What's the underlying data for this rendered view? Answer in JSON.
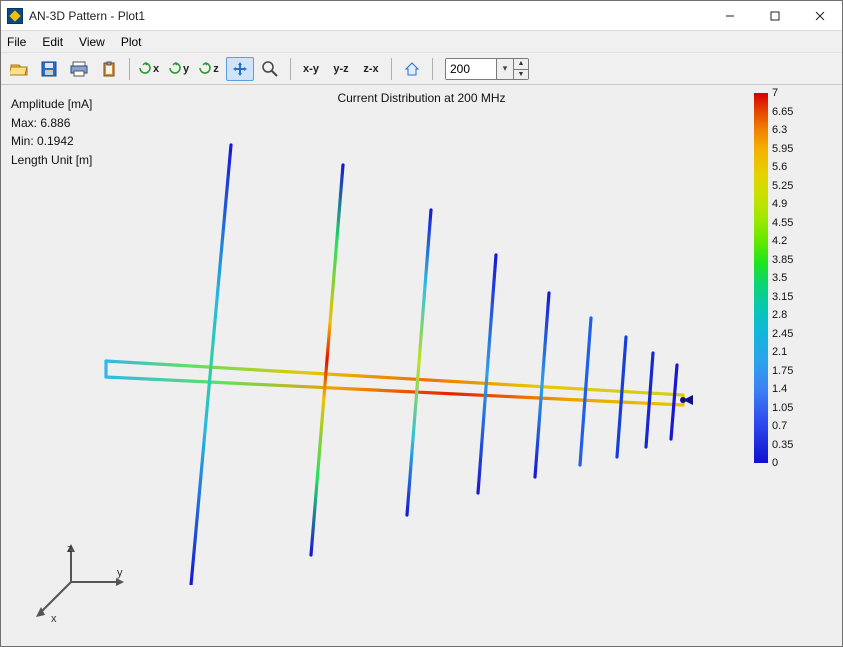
{
  "window": {
    "title": "AN-3D Pattern - Plot1"
  },
  "menus": [
    "File",
    "Edit",
    "View",
    "Plot"
  ],
  "toolbar": {
    "icons": {
      "open": "open-icon",
      "save": "save-icon",
      "print": "print-icon",
      "clipboard": "clipboard-icon",
      "rotx": "x",
      "roty": "y",
      "rotz": "z",
      "pan": "pan-icon",
      "zoom": "zoom-icon",
      "view_xy": "x-y",
      "view_yz": "y-z",
      "view_zx": "z-x",
      "home": "home-icon"
    },
    "freq": {
      "value": "200"
    }
  },
  "info": {
    "amp_label": "Amplitude [mA]",
    "max_label": "Max: 6.886",
    "min_label": "Min: 0.1942",
    "unit_label": "Length Unit [m]"
  },
  "plot": {
    "title": "Current Distribution at 200 MHz"
  },
  "legend": {
    "ticks": [
      "7",
      "6.65",
      "6.3",
      "5.95",
      "5.6",
      "5.25",
      "4.9",
      "4.55",
      "4.2",
      "3.85",
      "3.5",
      "3.15",
      "2.8",
      "2.45",
      "2.1",
      "1.75",
      "1.4",
      "1.05",
      "0.7",
      "0.35",
      "0"
    ]
  },
  "axis_labels": {
    "x": "x",
    "y": "y",
    "z": "z"
  },
  "chart_data": {
    "type": "3d-current-distribution",
    "title": "Current Distribution at 200 MHz",
    "quantity": "Amplitude",
    "unit_quantity": "mA",
    "unit_length": "m",
    "frequency_MHz": 200,
    "max": 6.886,
    "min": 0.1942,
    "colorbar_range": [
      0,
      7
    ],
    "colorbar_ticks": [
      7,
      6.65,
      6.3,
      5.95,
      5.6,
      5.25,
      4.9,
      4.55,
      4.2,
      3.85,
      3.5,
      3.15,
      2.8,
      2.45,
      2.1,
      1.75,
      1.4,
      1.05,
      0.7,
      0.35,
      0
    ],
    "elements": [
      {
        "index": 1,
        "type": "dipole",
        "approx_current_peak_mA": 1.5,
        "approx_current_ends_mA": 0.2
      },
      {
        "index": 2,
        "type": "dipole",
        "approx_current_peak_mA": 6.886,
        "approx_current_ends_mA": 0.5
      },
      {
        "index": 3,
        "type": "dipole",
        "approx_current_peak_mA": 4.5,
        "approx_current_ends_mA": 0.3
      },
      {
        "index": 4,
        "type": "dipole",
        "approx_current_peak_mA": 1.2,
        "approx_current_ends_mA": 0.2
      },
      {
        "index": 5,
        "type": "dipole",
        "approx_current_peak_mA": 0.6,
        "approx_current_ends_mA": 0.2
      },
      {
        "index": 6,
        "type": "dipole",
        "approx_current_peak_mA": 0.3,
        "approx_current_ends_mA": 0.2
      },
      {
        "index": 7,
        "type": "dipole",
        "approx_current_peak_mA": 0.25,
        "approx_current_ends_mA": 0.2
      },
      {
        "index": 8,
        "type": "dipole",
        "approx_current_peak_mA": 0.22,
        "approx_current_ends_mA": 0.2
      },
      {
        "index": 9,
        "type": "dipole",
        "approx_current_peak_mA": 0.2,
        "approx_current_ends_mA": 0.2
      },
      {
        "index": 10,
        "type": "boom-top",
        "approx_current_front_mA": 5.5,
        "approx_current_back_mA": 2.0
      },
      {
        "index": 11,
        "type": "boom-bottom",
        "approx_current_front_mA": 5.5,
        "approx_current_back_mA": 2.0
      }
    ]
  }
}
